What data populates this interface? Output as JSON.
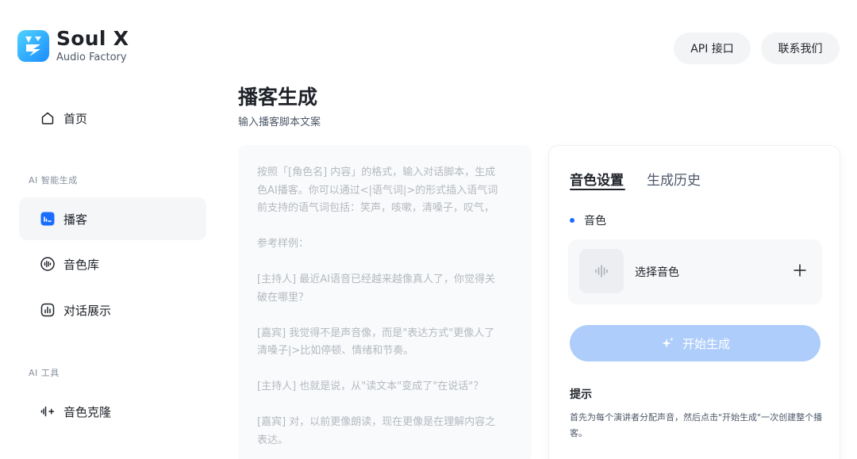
{
  "brand": {
    "name": "Soul X",
    "subtitle": "Audio Factory",
    "logo_color_start": "#4fd3ff",
    "logo_color_end": "#1a8cff"
  },
  "sidebar": {
    "home": {
      "label": "首页",
      "icon": "home-icon"
    },
    "sections": [
      {
        "label": "AI 智能生成"
      },
      {
        "label": "AI 工具"
      }
    ],
    "items": [
      {
        "label": "播客",
        "icon": "podcast-icon",
        "active": true
      },
      {
        "label": "音色库",
        "icon": "waveform-circle-icon",
        "active": false
      },
      {
        "label": "对话展示",
        "icon": "chart-icon",
        "active": false
      },
      {
        "label": "音色克隆",
        "icon": "audio-wave-icon",
        "active": false
      }
    ]
  },
  "header": {
    "api_button": "API 接口",
    "contact_button": "联系我们"
  },
  "main": {
    "title": "播客生成",
    "subtitle": "输入播客脚本文案",
    "script_placeholder": "按照「[角色名] 内容」的格式，输入对话脚本，生成\n色AI播客。你可以通过<|语气词|>的形式插入语气词\n前支持的语气词包括：笑声，咳嗽，清嗓子，叹气，\n\n参考样例：\n\n[主持人] 最近AI语音已经越来越像真人了，你觉得关\n破在哪里？\n\n[嘉宾] 我觉得不是声音像，而是\"表达方式\"更像人了\n清嗓子|>比如停顿、情绪和节奏。\n\n[主持人] 也就是说，从\"读文本\"变成了\"在说话\"？\n\n[嘉宾] 对，以前更像朗读，现在更像是在理解内容之\n表达。"
  },
  "panel": {
    "tabs": [
      {
        "label": "音色设置",
        "active": true
      },
      {
        "label": "生成历史",
        "active": false
      }
    ],
    "voice_section_label": "音色",
    "voice_select_label": "选择音色",
    "generate_button": "开始生成",
    "tip_title": "提示",
    "tip_text": "首先为每个演讲者分配声音，然后点击\"开始生成\"一次创建整个播客。"
  },
  "colors": {
    "accent": "#1a6dff",
    "button_disabled": "#aecdfb",
    "active_nav": "#1a6dff"
  }
}
